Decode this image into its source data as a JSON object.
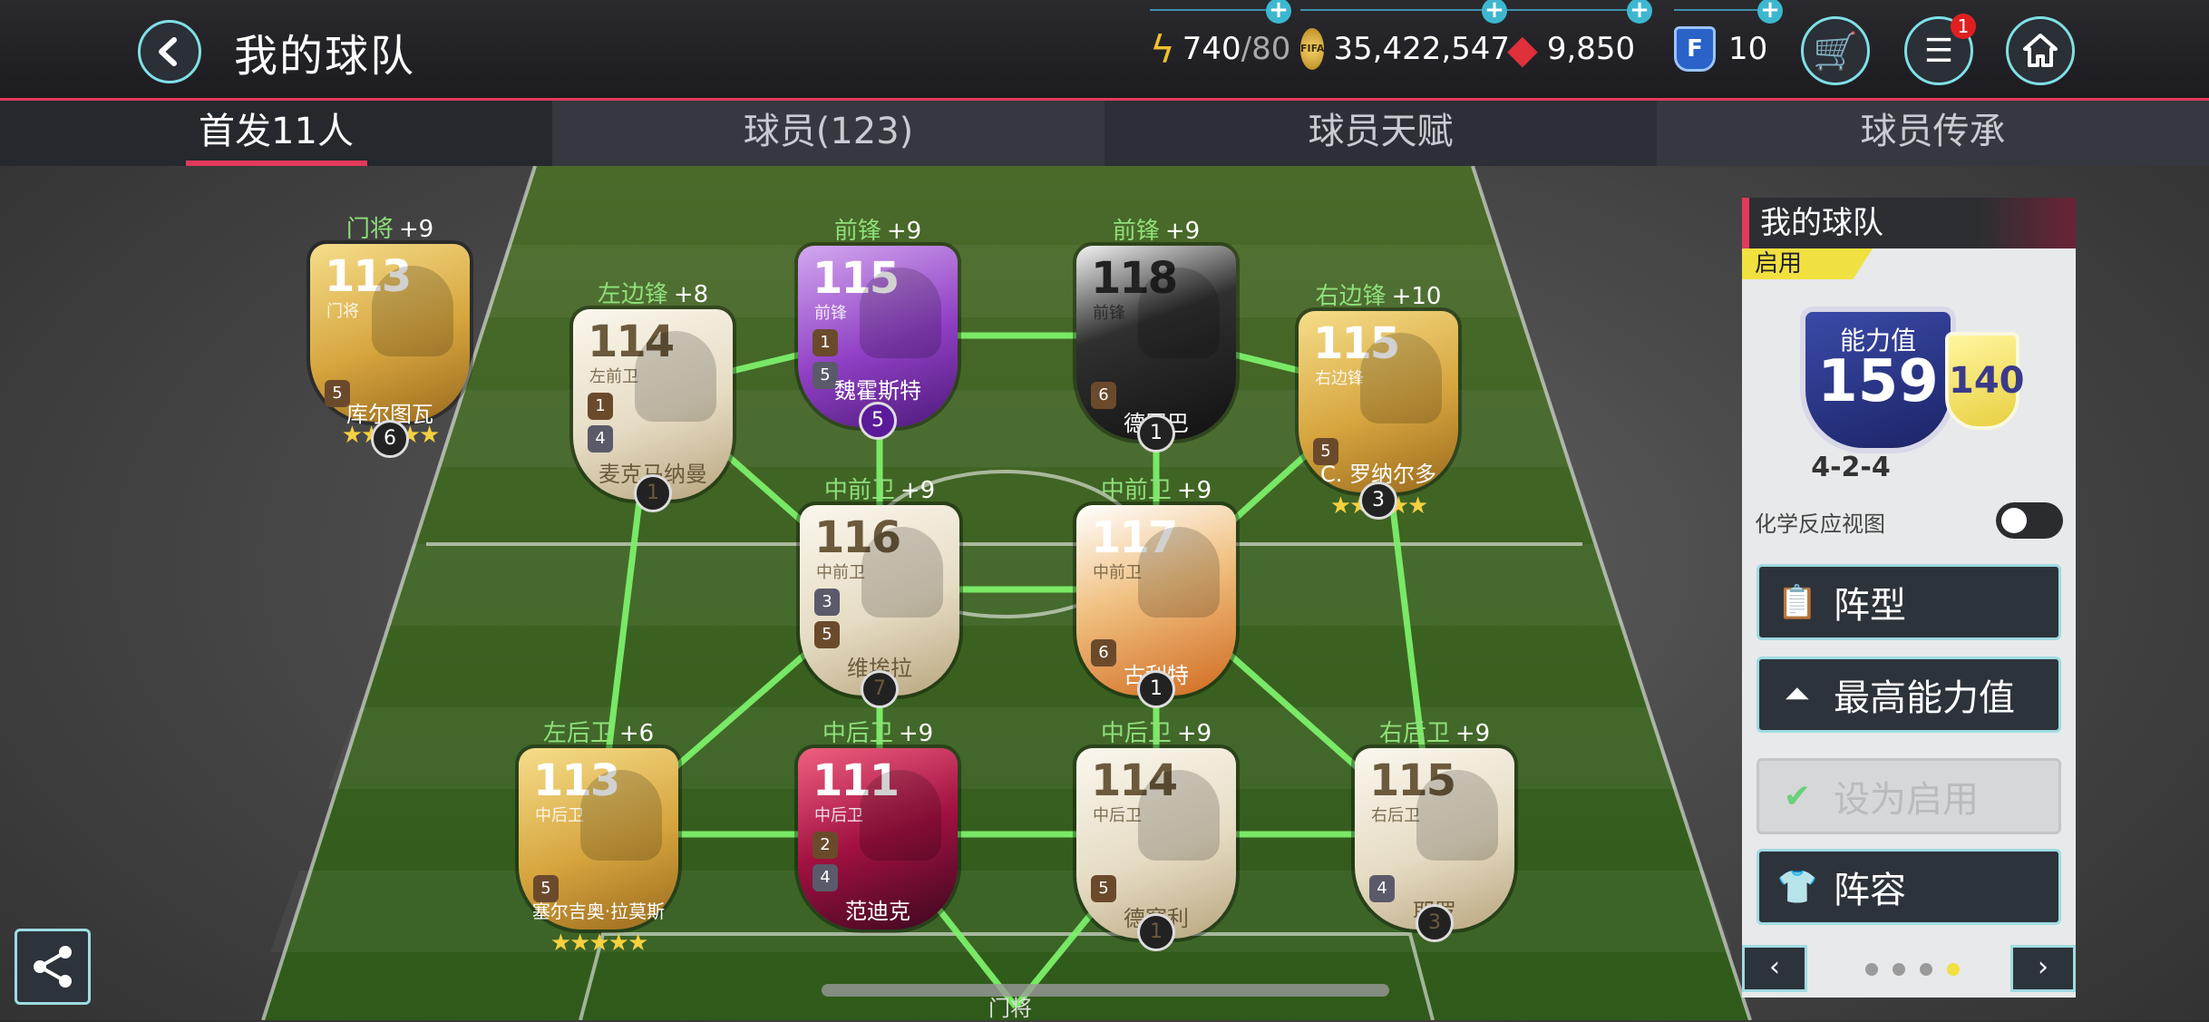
{
  "header": {
    "title": "我的球队",
    "energy": "740",
    "energy_max": "/80",
    "coins": "35,422,547",
    "gems": "9,850",
    "f_points": "10",
    "notification_count": "1"
  },
  "tabs": [
    {
      "label": "首发11人",
      "active": true
    },
    {
      "label": "球员(123)",
      "active": false
    },
    {
      "label": "球员天赋",
      "active": false
    },
    {
      "label": "球员传承",
      "active": false
    }
  ],
  "players": [
    {
      "pos": "门将",
      "chem": "+9",
      "ovr": "113",
      "abbr": "门将",
      "name": "库尔图瓦",
      "chip1": "5",
      "lvl": "6",
      "style": "gold"
    },
    {
      "pos": "左边锋",
      "chem": "+8",
      "ovr": "114",
      "abbr": "左前卫",
      "name": "麦克马纳曼",
      "chip1": "1",
      "chip2": "4",
      "lvl": "1",
      "style": "silver"
    },
    {
      "pos": "前锋",
      "chem": "+9",
      "ovr": "115",
      "abbr": "前锋",
      "name": "魏霍斯特",
      "chip1": "1",
      "chip2": "5",
      "lvl": "5",
      "style": "purple"
    },
    {
      "pos": "前锋",
      "chem": "+9",
      "ovr": "118",
      "abbr": "前锋",
      "name": "德罗巴",
      "chip1": "6",
      "lvl": "1",
      "style": "black"
    },
    {
      "pos": "右边锋",
      "chem": "+10",
      "ovr": "115",
      "abbr": "右边锋",
      "name": "C. 罗纳尔多",
      "chip1": "5",
      "lvl": "3",
      "style": "gold"
    },
    {
      "pos": "中前卫",
      "chem": "+9",
      "ovr": "116",
      "abbr": "中前卫",
      "name": "维埃拉",
      "chip1": "3",
      "chip2": "5",
      "lvl": "7",
      "style": "silver"
    },
    {
      "pos": "中前卫",
      "chem": "+9",
      "ovr": "117",
      "abbr": "中前卫",
      "name": "古利特",
      "chip1": "6",
      "lvl": "1",
      "style": "orange"
    },
    {
      "pos": "左后卫",
      "chem": "+6",
      "ovr": "113",
      "abbr": "中后卫",
      "name": "塞尔吉奥·拉莫斯",
      "chip1": "5",
      "lvl": "",
      "style": "gold"
    },
    {
      "pos": "中后卫",
      "chem": "+9",
      "ovr": "111",
      "abbr": "中后卫",
      "name": "范迪克",
      "chip1": "2",
      "chip2": "4",
      "lvl": "",
      "style": "vvd"
    },
    {
      "pos": "中后卫",
      "chem": "+9",
      "ovr": "114",
      "abbr": "中后卫",
      "name": "德塞利",
      "chip1": "5",
      "lvl": "1",
      "style": "silver"
    },
    {
      "pos": "右后卫",
      "chem": "+9",
      "ovr": "115",
      "abbr": "右后卫",
      "name": "耶罗",
      "chip1": "4",
      "lvl": "3",
      "style": "silver"
    }
  ],
  "panel": {
    "title": "我的球队",
    "status_tag": "启用",
    "rating_label": "能力值",
    "rating": "159",
    "rating_secondary": "140",
    "formation": "4-2-4",
    "chem_view_label": "化学反应视图",
    "buttons": {
      "formation": "阵型",
      "best_rating": "最高能力值",
      "set_active": "设为启用",
      "lineup": "阵容"
    },
    "page_count": 4,
    "page_active": 4
  },
  "bottom_label": "门将"
}
